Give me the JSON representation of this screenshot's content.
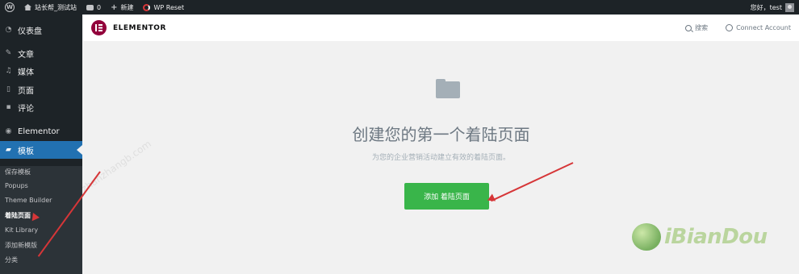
{
  "admin_bar": {
    "site_name": "站长帮_测试站",
    "comments_count": "0",
    "new_label": "新建",
    "wp_reset_label": "WP Reset",
    "greeting": "您好，test"
  },
  "sidebar": {
    "items": [
      {
        "label": "仪表盘",
        "icon": "dashboard-icon"
      },
      {
        "label": "文章",
        "icon": "pin-icon"
      },
      {
        "label": "媒体",
        "icon": "media-icon"
      },
      {
        "label": "页面",
        "icon": "page-icon"
      },
      {
        "label": "评论",
        "icon": "comment-icon"
      },
      {
        "label": "Elementor",
        "icon": "elementor-icon"
      },
      {
        "label": "模板",
        "icon": "folder-icon"
      }
    ],
    "submenu": [
      {
        "label": "保存模板"
      },
      {
        "label": "Popups"
      },
      {
        "label": "Theme Builder"
      },
      {
        "label": "着陆页面"
      },
      {
        "label": "Kit Library"
      },
      {
        "label": "添加新模版"
      },
      {
        "label": "分类"
      }
    ]
  },
  "elementor_header": {
    "brand": "ELEMENTOR",
    "search_label": "搜索",
    "connect_label": "Connect Account"
  },
  "main": {
    "title": "创建您的第一个着陆页面",
    "subtitle": "为您的企业营销活动建立有效的着陆页面。",
    "add_button": "添加 着陆页面"
  },
  "overlay": {
    "watermark_text": "zhanzhangb.com",
    "brand_watermark": "iBianDou"
  },
  "colors": {
    "admin_dark": "#1d2327",
    "active_blue": "#2271b1",
    "elementor_maroon": "#92003b",
    "button_green": "#39b54a",
    "annotation_red": "#d63638"
  }
}
